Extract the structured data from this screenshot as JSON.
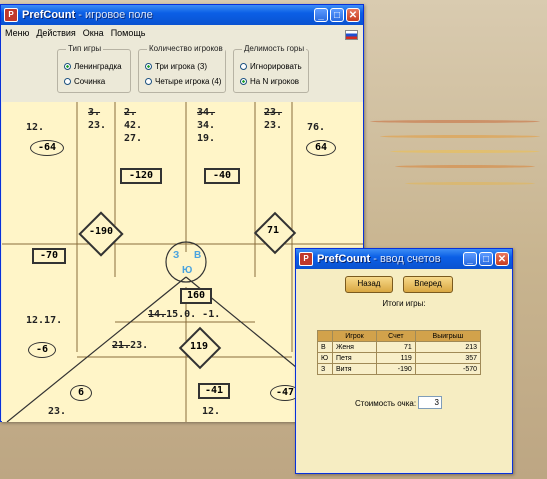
{
  "main_window": {
    "title": "PrefCount",
    "subtitle": " - игровое поле",
    "menu": [
      "Меню",
      "Действия",
      "Окна",
      "Помощь"
    ],
    "groups": {
      "game_type": {
        "legend": "Тип игры",
        "options": [
          "Ленинградка",
          "Сочинка"
        ],
        "selected": 0
      },
      "players": {
        "legend": "Количество игроков",
        "options": [
          "Три игрока (3)",
          "Четыре игрока (4)"
        ],
        "selected": 0
      },
      "mountain": {
        "legend": "Делимость горы",
        "options": [
          "Игнорировать",
          "На N игроков"
        ],
        "selected": 1
      }
    },
    "board": {
      "left_col": "12.",
      "left_oval": "-64",
      "c2_struck": "3.",
      "c2_val": "23.",
      "c3_struck": "2.",
      "c3_vals": [
        "42.",
        "27."
      ],
      "c3_box": "-120",
      "c4_struck": "34.",
      "c4_vals": [
        "34.",
        "19."
      ],
      "c4_box": "-40",
      "c5_struck": "23.",
      "c5_val": "23.",
      "right_col": "76.",
      "right_oval": "64",
      "diamond_left": "-190",
      "diamond_right": "71",
      "left_mid_box": "-70",
      "left_mid_text": "12.17.",
      "left_mid_oval": "-6",
      "players": [
        "З",
        "В",
        "Ю"
      ],
      "center_box": "160",
      "center_struck": "14.",
      "center_text": "15.0. -1.",
      "bottom_struck": "21.",
      "bottom_text": "23.",
      "diamond_bottom": "119",
      "bottom_oval": "6",
      "bottom_left_text": "23.",
      "bottom_box": "-41",
      "bottom_mid_text": "12.",
      "bottom_right_oval": "-47"
    }
  },
  "dialog": {
    "title": "PrefCount",
    "subtitle": " - ввод счетов",
    "back_label": "Назад",
    "next_label": "Вперед",
    "results_title": "Итоги игры:",
    "table_headers": [
      "",
      "Игрок",
      "Счет",
      "Выигрыш"
    ],
    "rows": [
      [
        "В",
        "Женя",
        "71",
        "213"
      ],
      [
        "Ю",
        "Петя",
        "119",
        "357"
      ],
      [
        "З",
        "Витя",
        "-190",
        "-570"
      ]
    ],
    "cost_label": "Стоимость очка:",
    "cost_value": "3"
  }
}
